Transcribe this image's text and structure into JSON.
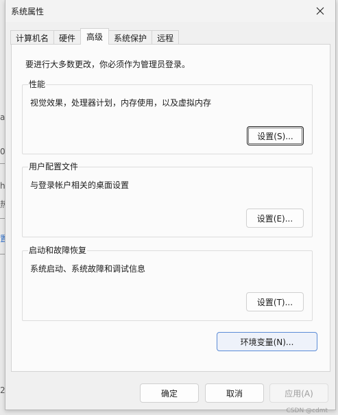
{
  "window": {
    "title": "系统属性",
    "close_label": "✕"
  },
  "tabs": [
    {
      "label": "计算机名",
      "active": false
    },
    {
      "label": "硬件",
      "active": false
    },
    {
      "label": "高级",
      "active": true
    },
    {
      "label": "系统保护",
      "active": false
    },
    {
      "label": "远程",
      "active": false
    }
  ],
  "advanced": {
    "admin_note": "要进行大多数更改，你必须作为管理员登录。",
    "performance": {
      "title": "性能",
      "description": "视觉效果，处理器计划，内存使用，以及虚拟内存",
      "button": "设置(S)..."
    },
    "user_profiles": {
      "title": "用户配置文件",
      "description": "与登录帐户相关的桌面设置",
      "button": "设置(E)..."
    },
    "startup_recovery": {
      "title": "启动和故障恢复",
      "description": "系统启动、系统故障和调试信息",
      "button": "设置(T)..."
    },
    "env_button": "环境变量(N)..."
  },
  "footer": {
    "ok": "确定",
    "cancel": "取消",
    "apply": "应用(A)"
  },
  "watermark": "CSDN @cdmt",
  "background_fragments": [
    "ac",
    "0",
    "h",
    "热",
    "置",
    "2"
  ]
}
